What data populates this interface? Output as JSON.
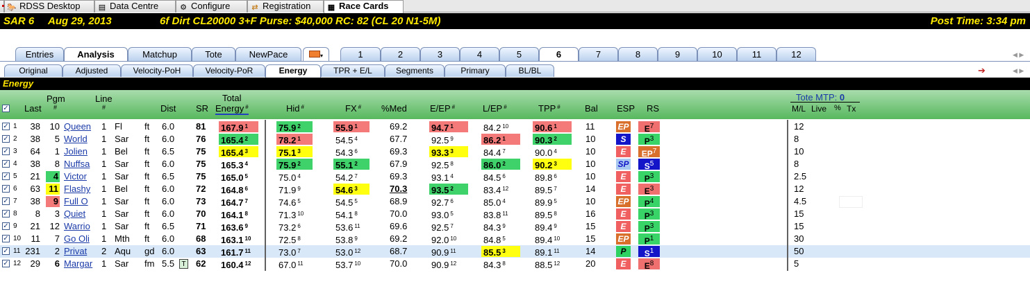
{
  "app_tabs": [
    {
      "label": "RDSS Desktop",
      "icon": "desktop-icon"
    },
    {
      "label": "Data Centre",
      "icon": "data-icon"
    },
    {
      "label": "Configure",
      "icon": "gear-icon"
    },
    {
      "label": "Registration",
      "icon": "registration-icon"
    },
    {
      "label": "Race Cards",
      "icon": "race-cards-icon",
      "active": true
    }
  ],
  "race": {
    "track_race": "SAR  6",
    "date": "Aug 29, 2013",
    "conditions": "6f  Dirt   CL20000  3+F   Purse: $40,000   RC: 82  (CL 20 N1-5M)",
    "post_time": "Post Time: 3:34 pm"
  },
  "tabs_main": [
    "Entries",
    "Analysis",
    "Matchup",
    "Tote",
    "NewPace"
  ],
  "tabs_main_active": "Analysis",
  "race_numbers": [
    "1",
    "2",
    "3",
    "4",
    "5",
    "6",
    "7",
    "8",
    "9",
    "10",
    "11",
    "12"
  ],
  "race_active": "6",
  "tabs_sub": [
    "Original",
    "Adjusted",
    "Velocity-PoH",
    "Velocity-PoR",
    "Energy",
    "TPR + E/L",
    "Segments",
    "Primary",
    "BL/BL"
  ],
  "tabs_sub_active": "Energy",
  "section_title": "Energy",
  "columns": {
    "last": "Last",
    "pgm": "Pgm",
    "pgm_hash": "#",
    "line": "Line",
    "line_hash": "#",
    "dist": "Dist",
    "sr": "SR",
    "total": "Total",
    "energy": "Energy",
    "energy_hash": "#",
    "hid": "Hid",
    "hid_hash": "#",
    "fx": "FX",
    "fx_hash": "#",
    "pmed": "%Med",
    "eep": "E/EP",
    "eep_hash": "#",
    "lep": "L/EP",
    "lep_hash": "#",
    "tpp": "TPP",
    "tpp_hash": "#",
    "bal": "Bal",
    "esp": "ESP",
    "rs": "RS",
    "tote_mtp_label": "Tote MTP:",
    "tote_mtp_value": "0",
    "ml": "M/L",
    "live": "Live",
    "pct": "%",
    "tx": "Tx"
  },
  "rows": [
    {
      "n": "1",
      "last": "38",
      "pgm": "10",
      "name": "Queen",
      "line": "1",
      "sx": "Fl",
      "surf": "ft",
      "dist": "6.0",
      "sr": "81",
      "te": "167.9",
      "ter": "1",
      "hid": "75.9",
      "hidr": "2",
      "fx": "55.9",
      "fxr": "1",
      "med": "69.2",
      "eep": "94.7",
      "eepr": "1",
      "lep": "84.2",
      "lepr": "10",
      "tpp": "90.6",
      "tppr": "1",
      "bal": "11",
      "esp": "EP",
      "rs": "E",
      "rsr": "7",
      "ml": "12"
    },
    {
      "n": "2",
      "last": "38",
      "pgm": "5",
      "name": "World",
      "line": "1",
      "sx": "Sar",
      "surf": "ft",
      "dist": "6.0",
      "sr": "76",
      "te": "165.4",
      "ter": "2",
      "hid": "78.2",
      "hidr": "1",
      "fx": "54.5",
      "fxr": "4",
      "med": "67.7",
      "eep": "92.5",
      "eepr": "9",
      "lep": "86.2",
      "lepr": "1",
      "tpp": "90.3",
      "tppr": "2",
      "bal": "10",
      "esp": "S",
      "rs": "P",
      "rsr": "3",
      "ml": "8"
    },
    {
      "n": "3",
      "last": "64",
      "pgm": "1",
      "name": "Jolien",
      "line": "1",
      "sx": "Bel",
      "surf": "ft",
      "dist": "6.5",
      "sr": "75",
      "te": "165.4",
      "ter": "3",
      "hid": "75.1",
      "hidr": "3",
      "fx": "54.3",
      "fxr": "6",
      "med": "69.3",
      "eep": "93.3",
      "eepr": "3",
      "lep": "84.4",
      "lepr": "7",
      "tpp": "90.0",
      "tppr": "4",
      "bal": "10",
      "esp": "E",
      "rs": "EP",
      "rsr": "7",
      "ml": "10"
    },
    {
      "n": "4",
      "last": "38",
      "pgm": "8",
      "name": "Nuffsa",
      "line": "1",
      "sx": "Sar",
      "surf": "ft",
      "dist": "6.0",
      "sr": "75",
      "te": "165.3",
      "ter": "4",
      "hid": "75.9",
      "hidr": "2",
      "fx": "55.1",
      "fxr": "2",
      "med": "67.9",
      "eep": "92.5",
      "eepr": "8",
      "lep": "86.0",
      "lepr": "2",
      "tpp": "90.2",
      "tppr": "3",
      "bal": "10",
      "esp": "SP",
      "rs": "S",
      "rsr": "5",
      "ml": "8"
    },
    {
      "n": "5",
      "last": "21",
      "pgm": "4",
      "name": "Victor",
      "line": "1",
      "sx": "Sar",
      "surf": "ft",
      "dist": "6.5",
      "sr": "75",
      "te": "165.0",
      "ter": "5",
      "hid": "75.0",
      "hidr": "4",
      "fx": "54.2",
      "fxr": "7",
      "med": "69.3",
      "eep": "93.1",
      "eepr": "4",
      "lep": "84.5",
      "lepr": "6",
      "tpp": "89.8",
      "tppr": "6",
      "bal": "10",
      "esp": "E",
      "rs": "P",
      "rsr": "3",
      "ml": "2.5"
    },
    {
      "n": "6",
      "last": "63",
      "pgm": "11",
      "name": "Flashy",
      "line": "1",
      "sx": "Bel",
      "surf": "ft",
      "dist": "6.0",
      "sr": "72",
      "te": "164.8",
      "ter": "6",
      "hid": "71.9",
      "hidr": "9",
      "fx": "54.6",
      "fxr": "3",
      "med": "70.3",
      "eep": "93.5",
      "eepr": "2",
      "lep": "83.4",
      "lepr": "12",
      "tpp": "89.5",
      "tppr": "7",
      "bal": "14",
      "esp": "E",
      "rs": "E",
      "rsr": "3",
      "ml": "12"
    },
    {
      "n": "7",
      "last": "38",
      "pgm": "9",
      "name": "Full O",
      "line": "1",
      "sx": "Sar",
      "surf": "ft",
      "dist": "6.0",
      "sr": "73",
      "te": "164.7",
      "ter": "7",
      "hid": "74.6",
      "hidr": "5",
      "fx": "54.5",
      "fxr": "5",
      "med": "68.9",
      "eep": "92.7",
      "eepr": "6",
      "lep": "85.0",
      "lepr": "4",
      "tpp": "89.9",
      "tppr": "5",
      "bal": "10",
      "esp": "EP",
      "rs": "P",
      "rsr": "4",
      "ml": "4.5"
    },
    {
      "n": "8",
      "last": "8",
      "pgm": "3",
      "name": "Quiet",
      "line": "1",
      "sx": "Sar",
      "surf": "ft",
      "dist": "6.0",
      "sr": "70",
      "te": "164.1",
      "ter": "8",
      "hid": "71.3",
      "hidr": "10",
      "fx": "54.1",
      "fxr": "8",
      "med": "70.0",
      "eep": "93.0",
      "eepr": "5",
      "lep": "83.8",
      "lepr": "11",
      "tpp": "89.5",
      "tppr": "8",
      "bal": "16",
      "esp": "E",
      "rs": "P",
      "rsr": "3",
      "ml": "15"
    },
    {
      "n": "9",
      "last": "21",
      "pgm": "12",
      "name": "Warrio",
      "line": "1",
      "sx": "Sar",
      "surf": "ft",
      "dist": "6.5",
      "sr": "71",
      "te": "163.6",
      "ter": "9",
      "hid": "73.2",
      "hidr": "6",
      "fx": "53.6",
      "fxr": "11",
      "med": "69.6",
      "eep": "92.5",
      "eepr": "7",
      "lep": "84.3",
      "lepr": "9",
      "tpp": "89.4",
      "tppr": "9",
      "bal": "15",
      "esp": "E",
      "rs": "P",
      "rsr": "3",
      "ml": "15"
    },
    {
      "n": "10",
      "last": "11",
      "pgm": "7",
      "name": "Go Oli",
      "line": "1",
      "sx": "Mth",
      "surf": "ft",
      "dist": "6.0",
      "sr": "68",
      "te": "163.1",
      "ter": "10",
      "hid": "72.5",
      "hidr": "8",
      "fx": "53.8",
      "fxr": "9",
      "med": "69.2",
      "eep": "92.0",
      "eepr": "10",
      "lep": "84.8",
      "lepr": "5",
      "tpp": "89.4",
      "tppr": "10",
      "bal": "15",
      "esp": "EP",
      "rs": "P",
      "rsr": "1",
      "ml": "30"
    },
    {
      "n": "11",
      "last": "231",
      "pgm": "2",
      "name": "Privat",
      "line": "2",
      "sx": "Aqu",
      "surf": "gd",
      "dist": "6.0",
      "sr": "63",
      "te": "161.7",
      "ter": "11",
      "hid": "73.0",
      "hidr": "7",
      "fx": "53.0",
      "fxr": "12",
      "med": "68.7",
      "eep": "90.9",
      "eepr": "11",
      "lep": "85.5",
      "lepr": "3",
      "tpp": "89.1",
      "tppr": "11",
      "bal": "14",
      "esp": "P",
      "rs": "S",
      "rsr": "1",
      "ml": "50"
    },
    {
      "n": "12",
      "last": "29",
      "pgm": "6",
      "name": "Margar",
      "line": "1",
      "sx": "Sar",
      "surf": "fm",
      "dist": "5.5",
      "tflag": "T",
      "sr": "62",
      "te": "160.4",
      "ter": "12",
      "hid": "67.0",
      "hidr": "11",
      "fx": "53.7",
      "fxr": "10",
      "med": "70.0",
      "eep": "90.9",
      "eepr": "12",
      "lep": "84.3",
      "lepr": "8",
      "tpp": "88.5",
      "tppr": "12",
      "bal": "20",
      "esp": "E",
      "rs": "E",
      "rsr": "8",
      "ml": "5"
    }
  ],
  "colors": {
    "red": "#f47a7a",
    "green": "#3fd26a",
    "yellow": "#ffff10",
    "esp_orange": "#d8702c",
    "esp_blue": "#1414c8",
    "esp_lightblue": "#a8c8f0",
    "esp_red": "#f06060",
    "esp_green": "#2ed262",
    "rs_red": "#f07070",
    "rs_green": "#38d468",
    "rs_blue": "#1414c8",
    "rs_orange": "#d8702c"
  }
}
